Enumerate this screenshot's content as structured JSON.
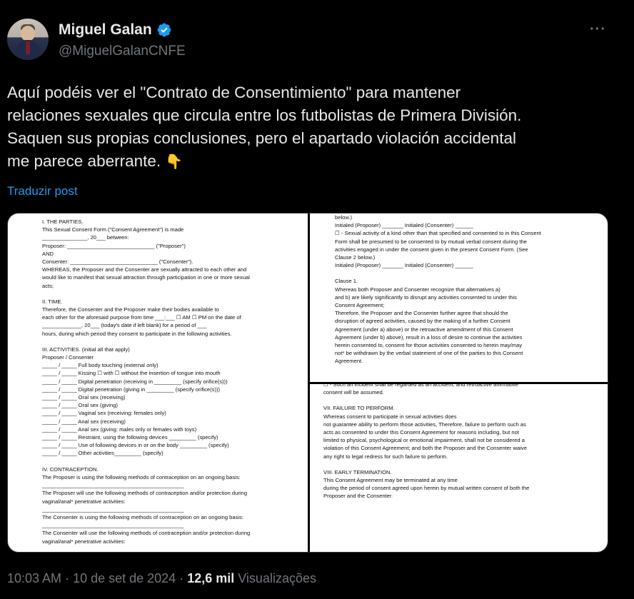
{
  "author": {
    "name": "Miguel Galan",
    "handle": "@MiguelGalanCNFE"
  },
  "tweet": {
    "lines": [
      "Aquí podéis ver el \"Contrato de Consentimiento\" para mantener",
      "relaciones sexuales que circula entre los futbolistas de Primera División.",
      "Saquen sus propias conclusiones, pero el apartado violación accidental",
      "me parece aberrante."
    ],
    "emoji": "👇",
    "translate_label": "Traduzir post"
  },
  "document": {
    "left_lines": [
      "I. THE PARTIES.",
      "This Sexual Consent Form (\"Consent Agreement\") is made",
      "_______________, 20___ between:",
      "Proposer: _____________________________ (\"Proposer\")",
      "AND",
      "Consenter: _____________________________ (\"Consenter\").",
      "WHEREAS, the Proposer and the Consenter are sexually attracted to each other and",
      "would like to manifest that sexual attraction through participation in one or more sexual",
      "acts;",
      "",
      "II. TIME.",
      "Therefore, the Consenter and the Proposer make their bodies available to",
      "each other for the aforesaid purpose from time ___:___ ☐ AM ☐ PM on the date of",
      "_____________, 20___ (today's date if left blank) for a period of ___",
      "hours, during which period they consent to participate in the following activities.",
      "",
      "III. ACTIVITIES. (initial all that apply)",
      "Proposer / Consenter",
      "_____ / _____ Full body touching (external only)",
      "_____ / _____ Kissing ☐ with ☐ without the insertion of tongue into mouth",
      "_____ / _____ Digital penetration (receiving in _________ (specify orifice(s)))",
      "_____ / _____ Digital penetration (giving in _________ (specify orifice(s)))",
      "_____ / _____ Oral sex (receiving)",
      "_____ / _____ Oral sex (giving)",
      "_____ / _____ Vaginal sex (receiving: females only)",
      "_____ / _____ Anal sex (receiving)",
      "_____ / _____ Anal sex (giving: males only or females with toys)",
      "_____ / _____ Restraint, using the following devices _________ (specify)",
      "_____ / _____ Use of following devices in or on the body _________ (specify)",
      "_____ / _____ Other activities_________ (specify)",
      "",
      "IV. CONTRACEPTION.",
      "The Proposer is using the following methods of contraception on an ongoing basis:",
      "_______________________________________________",
      "The Proposer will use the following methods of contraception and/or protection during",
      "vaginal/anal* penetrative activities:",
      "_______________________________________________",
      "The Consenter is using the following methods of contraception on an ongoing basis:",
      "_______________________________________________",
      "The Consenter will use the following methods of contraception and/or protection during",
      "vaginal/anal* penetrative activities:"
    ],
    "right_top_lines": [
      "below.)",
      "Initialed (Proposer) _______ Initialed (Consenter) ______",
      "☐ - Sexual activity of a kind other than that specified and consented to in this Consent",
      "Form shall be presumed to be consented to by mutual verbal consent during the",
      "activities engaged in under the consent given in the present Consent Form. (See",
      "Clause 2 below.)",
      "Initialed (Proposer) _______ Initialed (Consenter) ______",
      "",
      "Clause 1.",
      "Whereas both Proposer and Consenter recognize that alternatives a)",
      "and b) are likely significantly to disrupt any activities consented to under this",
      "Consent Agreement;",
      "Therefore, the Proposer and the Consenter further agree that should the",
      "disruption of agreed activities, caused by the making of a further Consent",
      "Agreement (under a) above) or the retroactive amendment of this Consent",
      "Agreement (under b) above), result in a loss of desire to continue the activities",
      "herein consented to, consent for those activities consented to herein may/may",
      "not* be withdrawn by the verbal statement of one of the parties to this Consent",
      "Agreement."
    ],
    "right_bottom_lines": [
      "☐ - Such an incident shall be regarded as an accident, and retroactive affirmative",
      "consent will be assumed.",
      "",
      "VII. FAILURE TO PERFORM.",
      "Whereas consent to participate in sexual activities does",
      "not guarantee ability to perform those activities, Therefore, failure to perform such as",
      "acts as consented to under this Consent Agreement for reasons including, but not",
      "limited to physical, psychological or emotional impairment, shall not be considered a",
      "violation of this Consent Agreement; and both the Proposer and the Consenter waive",
      "any right to legal redress for such failure to perform.",
      "",
      "VIII. EARLY TERMINATION.",
      "This Consent Agreement may be terminated at any time",
      "during the period of consent agreed upon herein by mutual written consent of both the",
      "Proposer and the Consenter."
    ]
  },
  "meta": {
    "time": "10:03 AM",
    "separator": " · ",
    "date": "10 de set de 2024",
    "views_count": "12,6 mil",
    "views_label": "Visualizações"
  },
  "colors": {
    "background": "#000000",
    "text": "#e7e9ea",
    "secondary": "#71767b",
    "link": "#1d9bf0",
    "verified": "#1d9bf0"
  }
}
